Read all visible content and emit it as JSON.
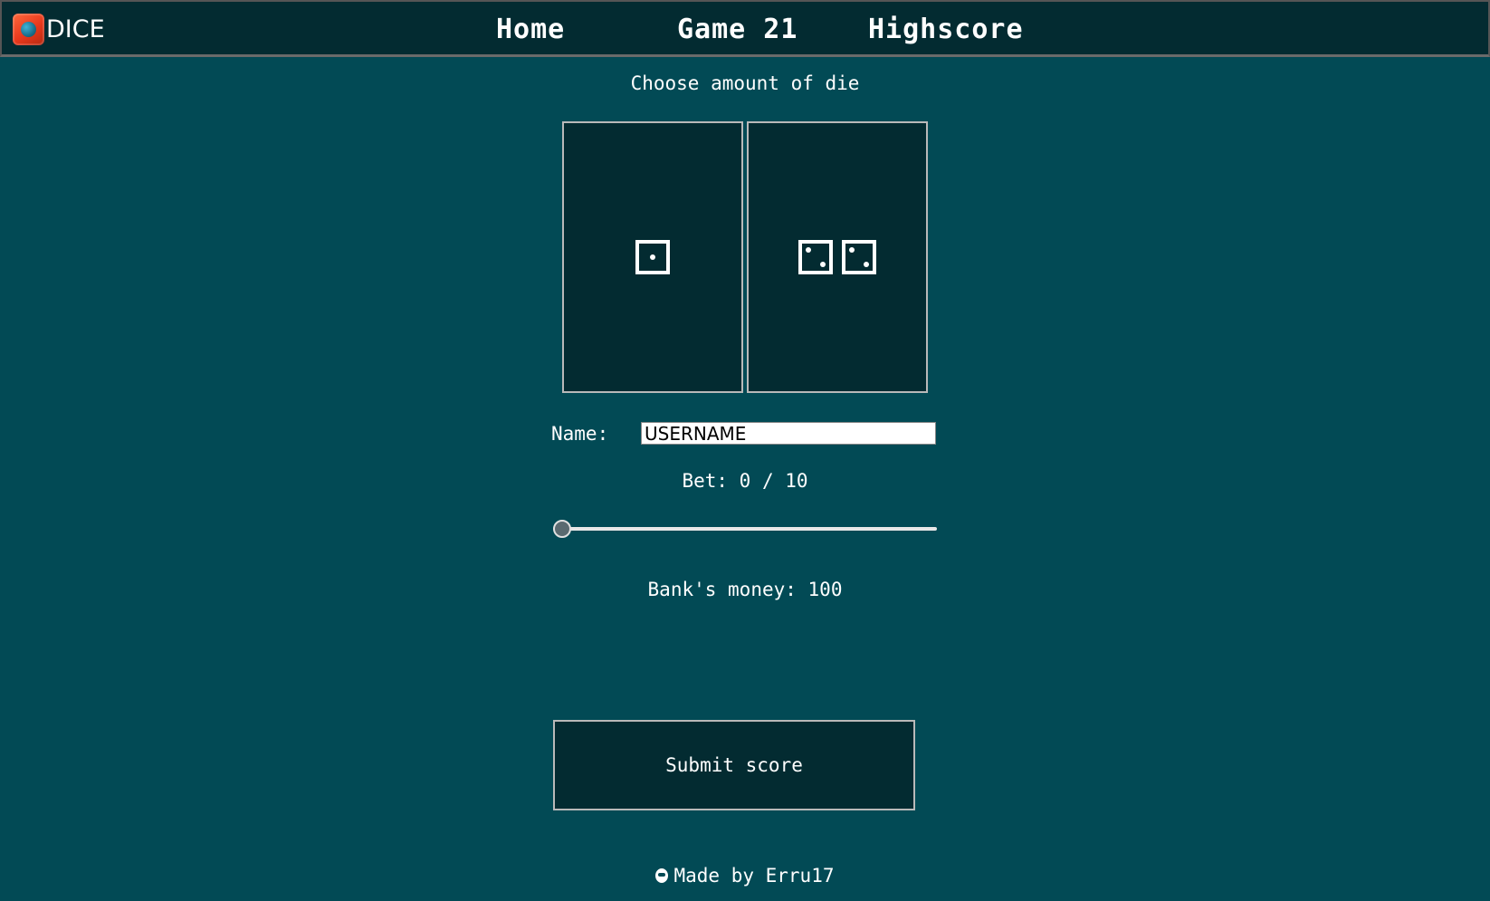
{
  "nav": {
    "brand": "DICE",
    "links": [
      "Home",
      "Game 21",
      "Highscore"
    ]
  },
  "game": {
    "heading": "Choose amount of die",
    "die_options": [
      {
        "dice_count": 1,
        "faces": [
          1
        ]
      },
      {
        "dice_count": 2,
        "faces": [
          2,
          2
        ]
      }
    ],
    "name_label": "Name:",
    "name_value": "USERNAME",
    "bet_text": "Bet: 0 / 10",
    "bet": {
      "value": 0,
      "max": 10
    },
    "bank_text": "Bank's money: 100",
    "submit_label": "Submit score"
  },
  "footer": {
    "text": "Made by Erru17"
  },
  "colors": {
    "background": "#024a55",
    "panel": "#032b31",
    "border": "#b9b9b9",
    "logo": "#e8381c"
  }
}
